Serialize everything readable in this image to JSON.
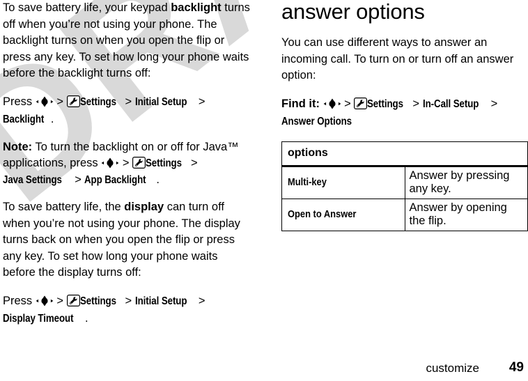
{
  "watermark": {
    "text": "DRAFT",
    "color": "#d9d9d9"
  },
  "icons": {
    "nav_key": "navigation-key-icon",
    "settings": "settings-wrench-icon"
  },
  "left_column": {
    "paragraph_backlight": {
      "part1": "To save battery life, your keypad ",
      "bold1": "backlight",
      "part2": " turns off when you’re not using your phone. The backlight turns on when you open the flip or press any key. To set how long your phone waits before the backlight turns off:"
    },
    "nav_backlight": {
      "lead": "Press ",
      "sep": " > ",
      "settings": "Settings",
      "step2": "Initial Setup",
      "step3": "Backlight",
      "period": "."
    },
    "note_java": {
      "label": "Note:",
      "text1": " To turn the backlight on or off for Java™ applications, press ",
      "sep": " > ",
      "settings": "Settings",
      "step2": "Java Settings",
      "step3": "App Backlight",
      "period": "."
    },
    "paragraph_display": {
      "part1": "To save battery life, the ",
      "bold1": "display",
      "part2": " can turn off when you’re not using your phone. The display turns back on when you open the flip or press any key. To set how long your phone waits before the display turns off:"
    },
    "nav_display": {
      "lead": "Press ",
      "sep": " > ",
      "settings": "Settings",
      "step2": "Initial Setup",
      "step3": "Display Timeout",
      "period": "."
    }
  },
  "right_column": {
    "heading": "answer options",
    "intro": "You can use different ways to answer an incoming call. To turn on or turn off an answer option:",
    "find_it": {
      "label": "Find it:",
      "sep": " > ",
      "settings": "Settings",
      "step2": "In-Call Setup",
      "step3": "Answer Options"
    },
    "table": {
      "header": "options",
      "rows": [
        {
          "key": "Multi-key",
          "value": "Answer by pressing any key."
        },
        {
          "key": "Open to Answer",
          "value": "Answer by opening the flip."
        }
      ]
    }
  },
  "footer": {
    "section": "customize",
    "page_number": "49"
  }
}
